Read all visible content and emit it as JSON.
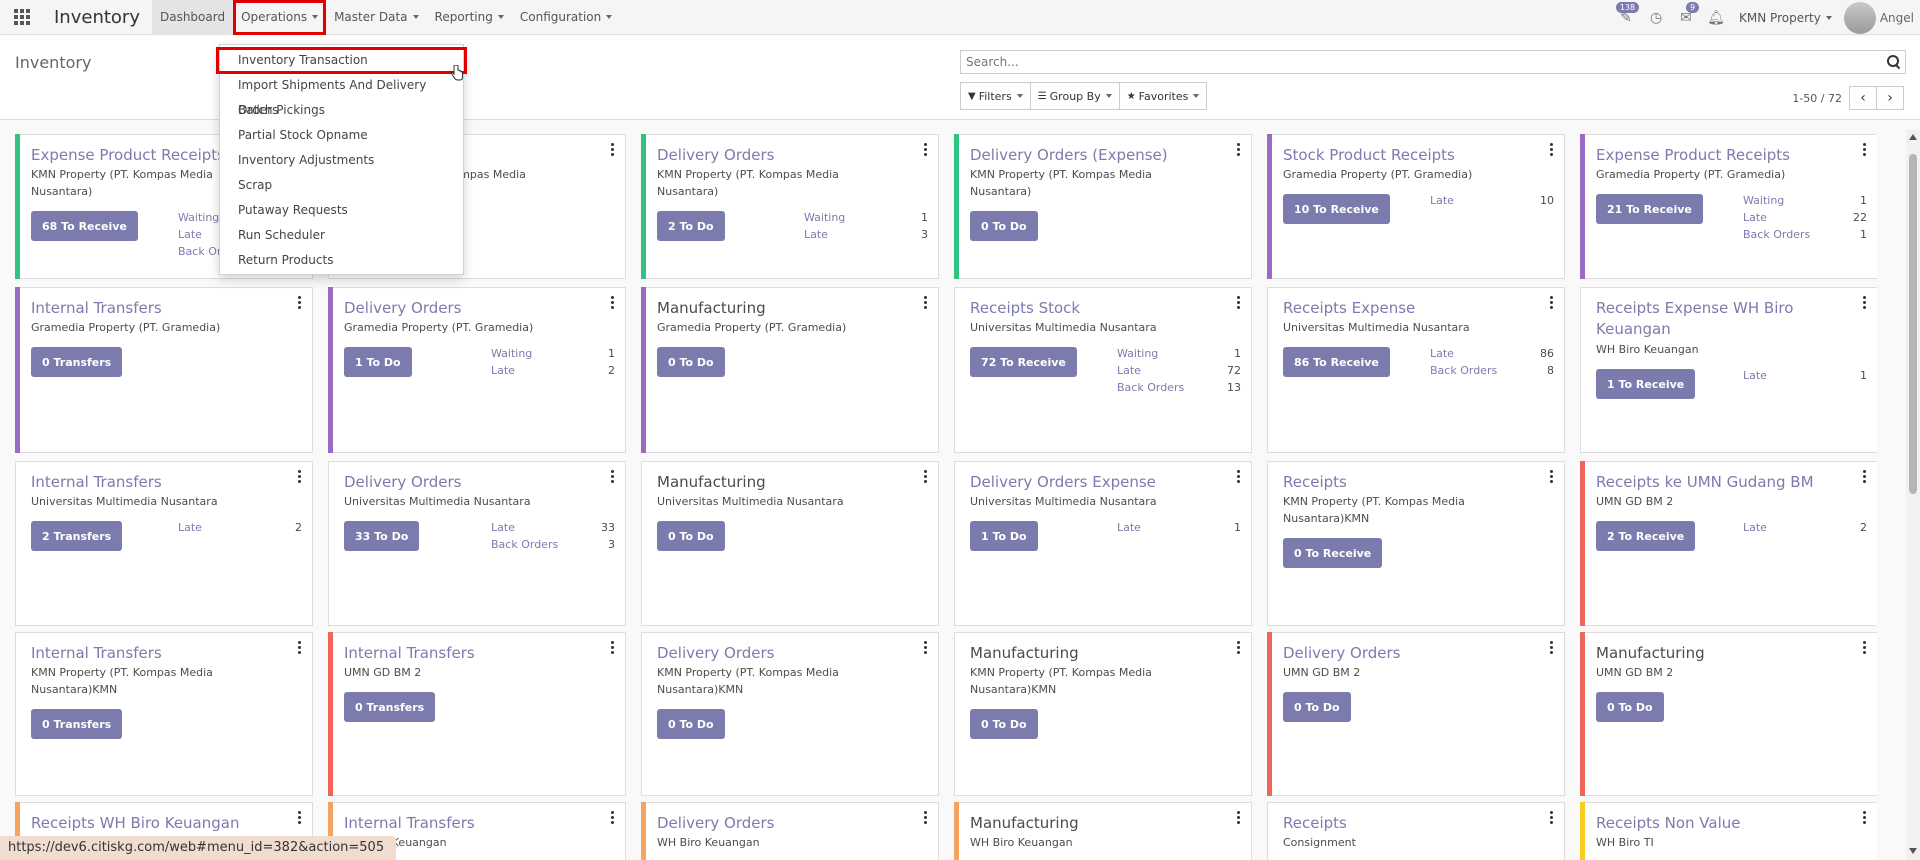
{
  "navbar": {
    "brand": "Inventory",
    "menu": [
      "Dashboard",
      "Operations",
      "Master Data",
      "Reporting",
      "Configuration"
    ],
    "activity_badge": "138",
    "messages_badge": "9",
    "company": "KMN Property",
    "user": "Angel"
  },
  "control": {
    "breadcrumb": "Inventory",
    "search_placeholder": "Search...",
    "filters": "Filters",
    "group_by": "Group By",
    "favorites": "Favorites",
    "pager": "1-50 / 72"
  },
  "dropdown": {
    "items": [
      "Inventory Transaction",
      "Import Shipments And Delivery Orders",
      "Batch Pickings",
      "Partial Stock Opname",
      "Inventory Adjustments",
      "Scrap",
      "Putaway Requests",
      "Run Scheduler",
      "Return Products"
    ]
  },
  "colors": {
    "purple": "#7c7bad",
    "green": "#30c381",
    "violet": "#9b6bc4",
    "red": "#f0645a",
    "orange": "#f4a460",
    "yellow": "#f7cd1f",
    "highlight": "#e00000"
  },
  "cards": [
    {
      "title": "Expense Product Receipts",
      "sub": "KMN Property (PT. Kompas Media Nusantara)",
      "action": "68 To Receive",
      "stats": [
        {
          "label": "Waiting",
          "value": ""
        },
        {
          "label": "Late",
          "value": ""
        },
        {
          "label": "Back Orders",
          "value": ""
        }
      ]
    },
    {
      "title": "",
      "sub": "KMN Property (PT. Kompas Media Nusantara)",
      "action": "",
      "stats": []
    },
    {
      "title": "Delivery Orders",
      "sub": "KMN Property (PT. Kompas Media Nusantara)",
      "action": "2 To Do",
      "stats": [
        {
          "label": "Waiting",
          "value": "1"
        },
        {
          "label": "Late",
          "value": "3"
        }
      ]
    },
    {
      "title": "Delivery Orders (Expense)",
      "sub": "KMN Property (PT. Kompas Media Nusantara)",
      "action": "0 To Do",
      "stats": []
    },
    {
      "title": "Stock Product Receipts",
      "sub": "Gramedia Property (PT. Gramedia)",
      "action": "10 To Receive",
      "stats": [
        {
          "label": "Late",
          "value": "10"
        }
      ]
    },
    {
      "title": "Expense Product Receipts",
      "sub": "Gramedia Property (PT. Gramedia)",
      "action": "21 To Receive",
      "stats": [
        {
          "label": "Waiting",
          "value": "1"
        },
        {
          "label": "Late",
          "value": "22"
        },
        {
          "label": "Back Orders",
          "value": "1"
        }
      ]
    },
    {
      "title": "Internal Transfers",
      "sub": "Gramedia Property (PT. Gramedia)",
      "action": "0 Transfers",
      "stats": []
    },
    {
      "title": "Delivery Orders",
      "sub": "Gramedia Property (PT. Gramedia)",
      "action": "1 To Do",
      "stats": [
        {
          "label": "Waiting",
          "value": "1"
        },
        {
          "label": "Late",
          "value": "2"
        }
      ]
    },
    {
      "title": "Manufacturing",
      "sub": "Gramedia Property (PT. Gramedia)",
      "action": "0 To Do",
      "stats": []
    },
    {
      "title": "Receipts Stock",
      "sub": "Universitas Multimedia Nusantara",
      "action": "72 To Receive",
      "stats": [
        {
          "label": "Waiting",
          "value": "1"
        },
        {
          "label": "Late",
          "value": "72"
        },
        {
          "label": "Back Orders",
          "value": "13"
        }
      ]
    },
    {
      "title": "Receipts Expense",
      "sub": "Universitas Multimedia Nusantara",
      "action": "86 To Receive",
      "stats": [
        {
          "label": "Late",
          "value": "86"
        },
        {
          "label": "Back Orders",
          "value": "8"
        }
      ]
    },
    {
      "title": "Receipts Expense WH Biro Keuangan",
      "sub": "WH Biro Keuangan",
      "action": "1 To Receive",
      "stats": [
        {
          "label": "Late",
          "value": "1"
        }
      ]
    },
    {
      "title": "Internal Transfers",
      "sub": "Universitas Multimedia Nusantara",
      "action": "2 Transfers",
      "stats": [
        {
          "label": "Late",
          "value": "2"
        }
      ]
    },
    {
      "title": "Delivery Orders",
      "sub": "Universitas Multimedia Nusantara",
      "action": "33 To Do",
      "stats": [
        {
          "label": "Late",
          "value": "33"
        },
        {
          "label": "Back Orders",
          "value": "3"
        }
      ]
    },
    {
      "title": "Manufacturing",
      "sub": "Universitas Multimedia Nusantara",
      "action": "0 To Do",
      "stats": []
    },
    {
      "title": "Delivery Orders Expense",
      "sub": "Universitas Multimedia Nusantara",
      "action": "1 To Do",
      "stats": [
        {
          "label": "Late",
          "value": "1"
        }
      ]
    },
    {
      "title": "Receipts",
      "sub": "KMN Property (PT. Kompas Media Nusantara)KMN",
      "action": "0 To Receive",
      "stats": []
    },
    {
      "title": "Receipts ke UMN Gudang BM",
      "sub": "UMN GD BM 2",
      "action": "2 To Receive",
      "stats": [
        {
          "label": "Late",
          "value": "2"
        }
      ]
    },
    {
      "title": "Internal Transfers",
      "sub": "KMN Property (PT. Kompas Media Nusantara)KMN",
      "action": "0 Transfers",
      "stats": []
    },
    {
      "title": "Internal Transfers",
      "sub": "UMN GD BM 2",
      "action": "0 Transfers",
      "stats": []
    },
    {
      "title": "Delivery Orders",
      "sub": "KMN Property (PT. Kompas Media Nusantara)KMN",
      "action": "0 To Do",
      "stats": []
    },
    {
      "title": "Manufacturing",
      "sub": "KMN Property (PT. Kompas Media Nusantara)KMN",
      "action": "0 To Do",
      "stats": []
    },
    {
      "title": "Delivery Orders",
      "sub": "UMN GD BM 2",
      "action": "0 To Do",
      "stats": []
    },
    {
      "title": "Manufacturing",
      "sub": "UMN GD BM 2",
      "action": "0 To Do",
      "stats": []
    },
    {
      "title": "Receipts WH Biro Keuangan",
      "sub": "",
      "action": "",
      "stats": []
    },
    {
      "title": "Internal Transfers",
      "sub": "WH Biro Keuangan",
      "action": "",
      "stats": []
    },
    {
      "title": "Delivery Orders",
      "sub": "WH Biro Keuangan",
      "action": "",
      "stats": []
    },
    {
      "title": "Manufacturing",
      "sub": "WH Biro Keuangan",
      "action": "",
      "stats": []
    },
    {
      "title": "Receipts",
      "sub": "Consignment",
      "action": "",
      "stats": []
    },
    {
      "title": "Receipts Non Value",
      "sub": "WH Biro TI",
      "action": "",
      "stats": []
    }
  ],
  "status_url": "https://dev6.citiskg.com/web#menu_id=382&action=505"
}
